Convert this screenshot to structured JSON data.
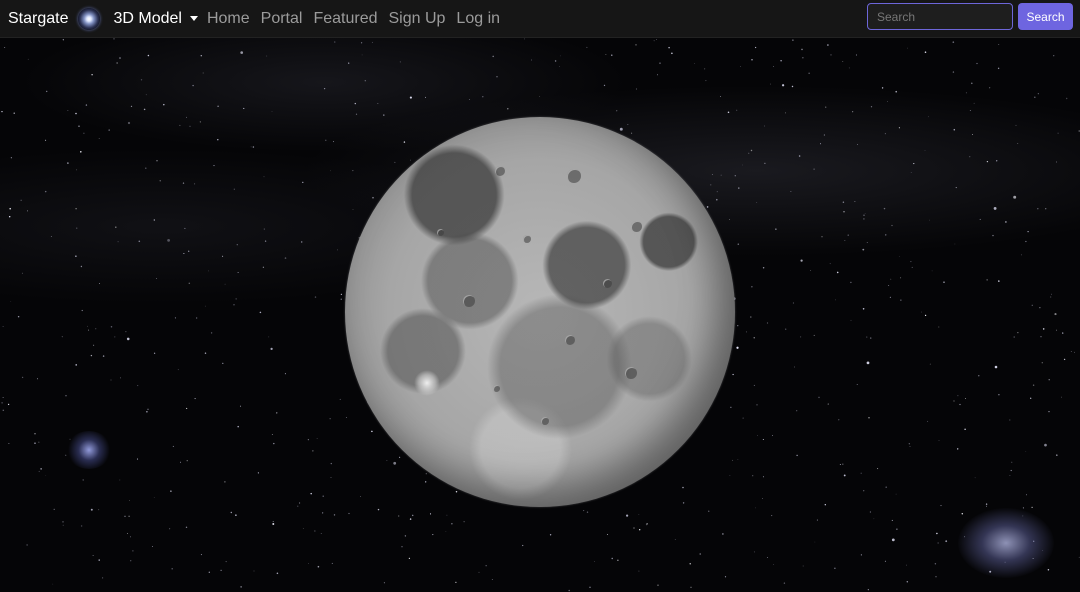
{
  "nav": {
    "brand": "Stargate",
    "brand_icon": "galaxy-icon",
    "dropdown_label": "3D Model",
    "links": [
      "Home",
      "Portal",
      "Featured",
      "Sign Up",
      "Log in"
    ]
  },
  "search": {
    "placeholder": "Search",
    "value": "",
    "button_label": "Search"
  },
  "scene": {
    "subject": "moon"
  },
  "colors": {
    "navbar_bg": "#161616",
    "accent": "#6e65e0",
    "link": "#9b9b9b",
    "space_bg": "#050507"
  }
}
